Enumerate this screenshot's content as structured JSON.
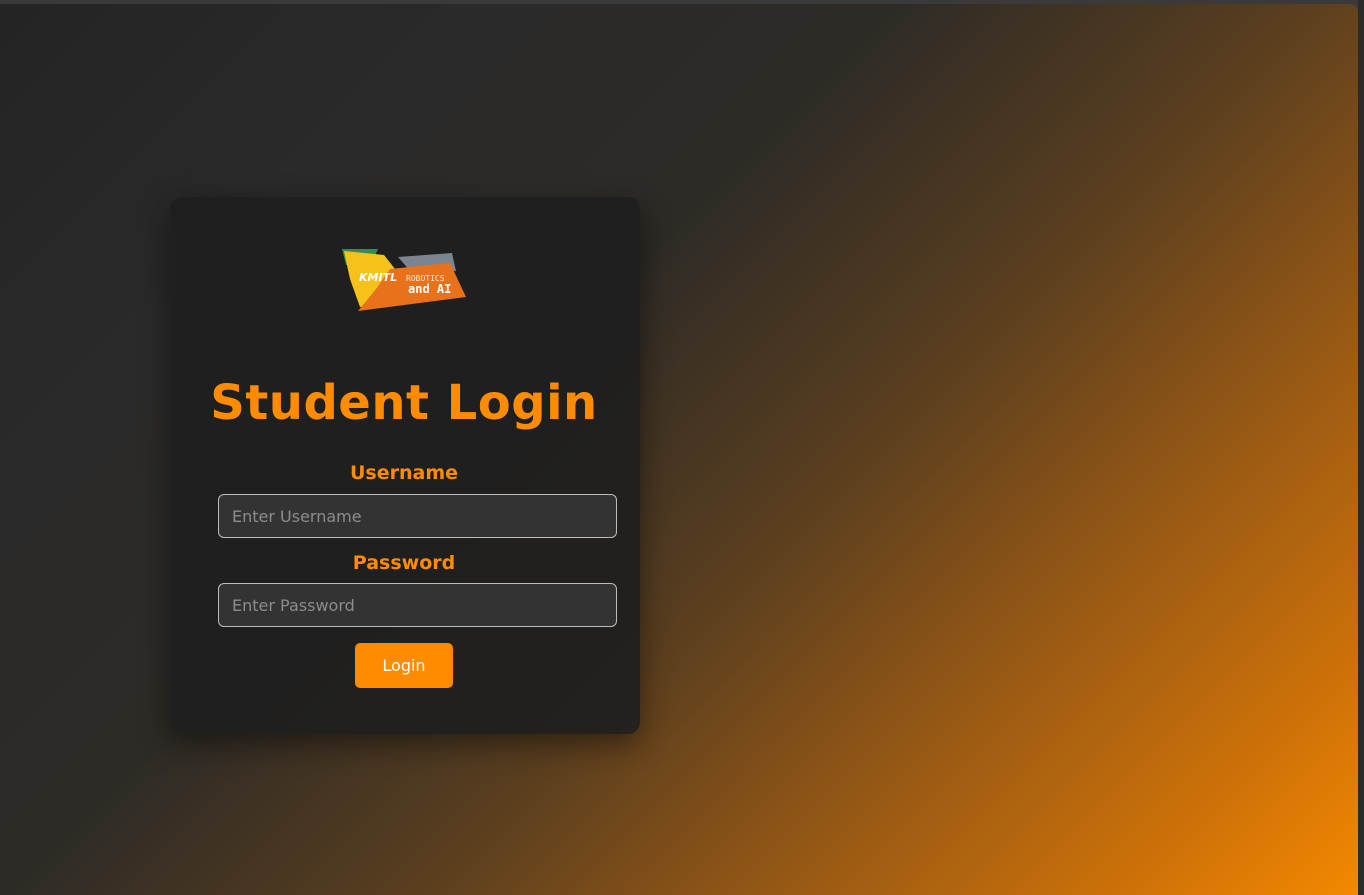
{
  "login": {
    "title": "Student Login",
    "logo": {
      "left_text": "KMITL",
      "right_top_text": "ROBOTICS",
      "right_bottom_text": "and AI"
    },
    "username": {
      "label": "Username",
      "placeholder": "Enter Username",
      "value": ""
    },
    "password": {
      "label": "Password",
      "placeholder": "Enter Password",
      "value": ""
    },
    "submit_label": "Login"
  },
  "colors": {
    "accent": "#ff8c00",
    "card_bg": "#1e1e1e",
    "input_bg": "#333333",
    "gradient_start": "#242424",
    "gradient_end": "#f48900"
  }
}
